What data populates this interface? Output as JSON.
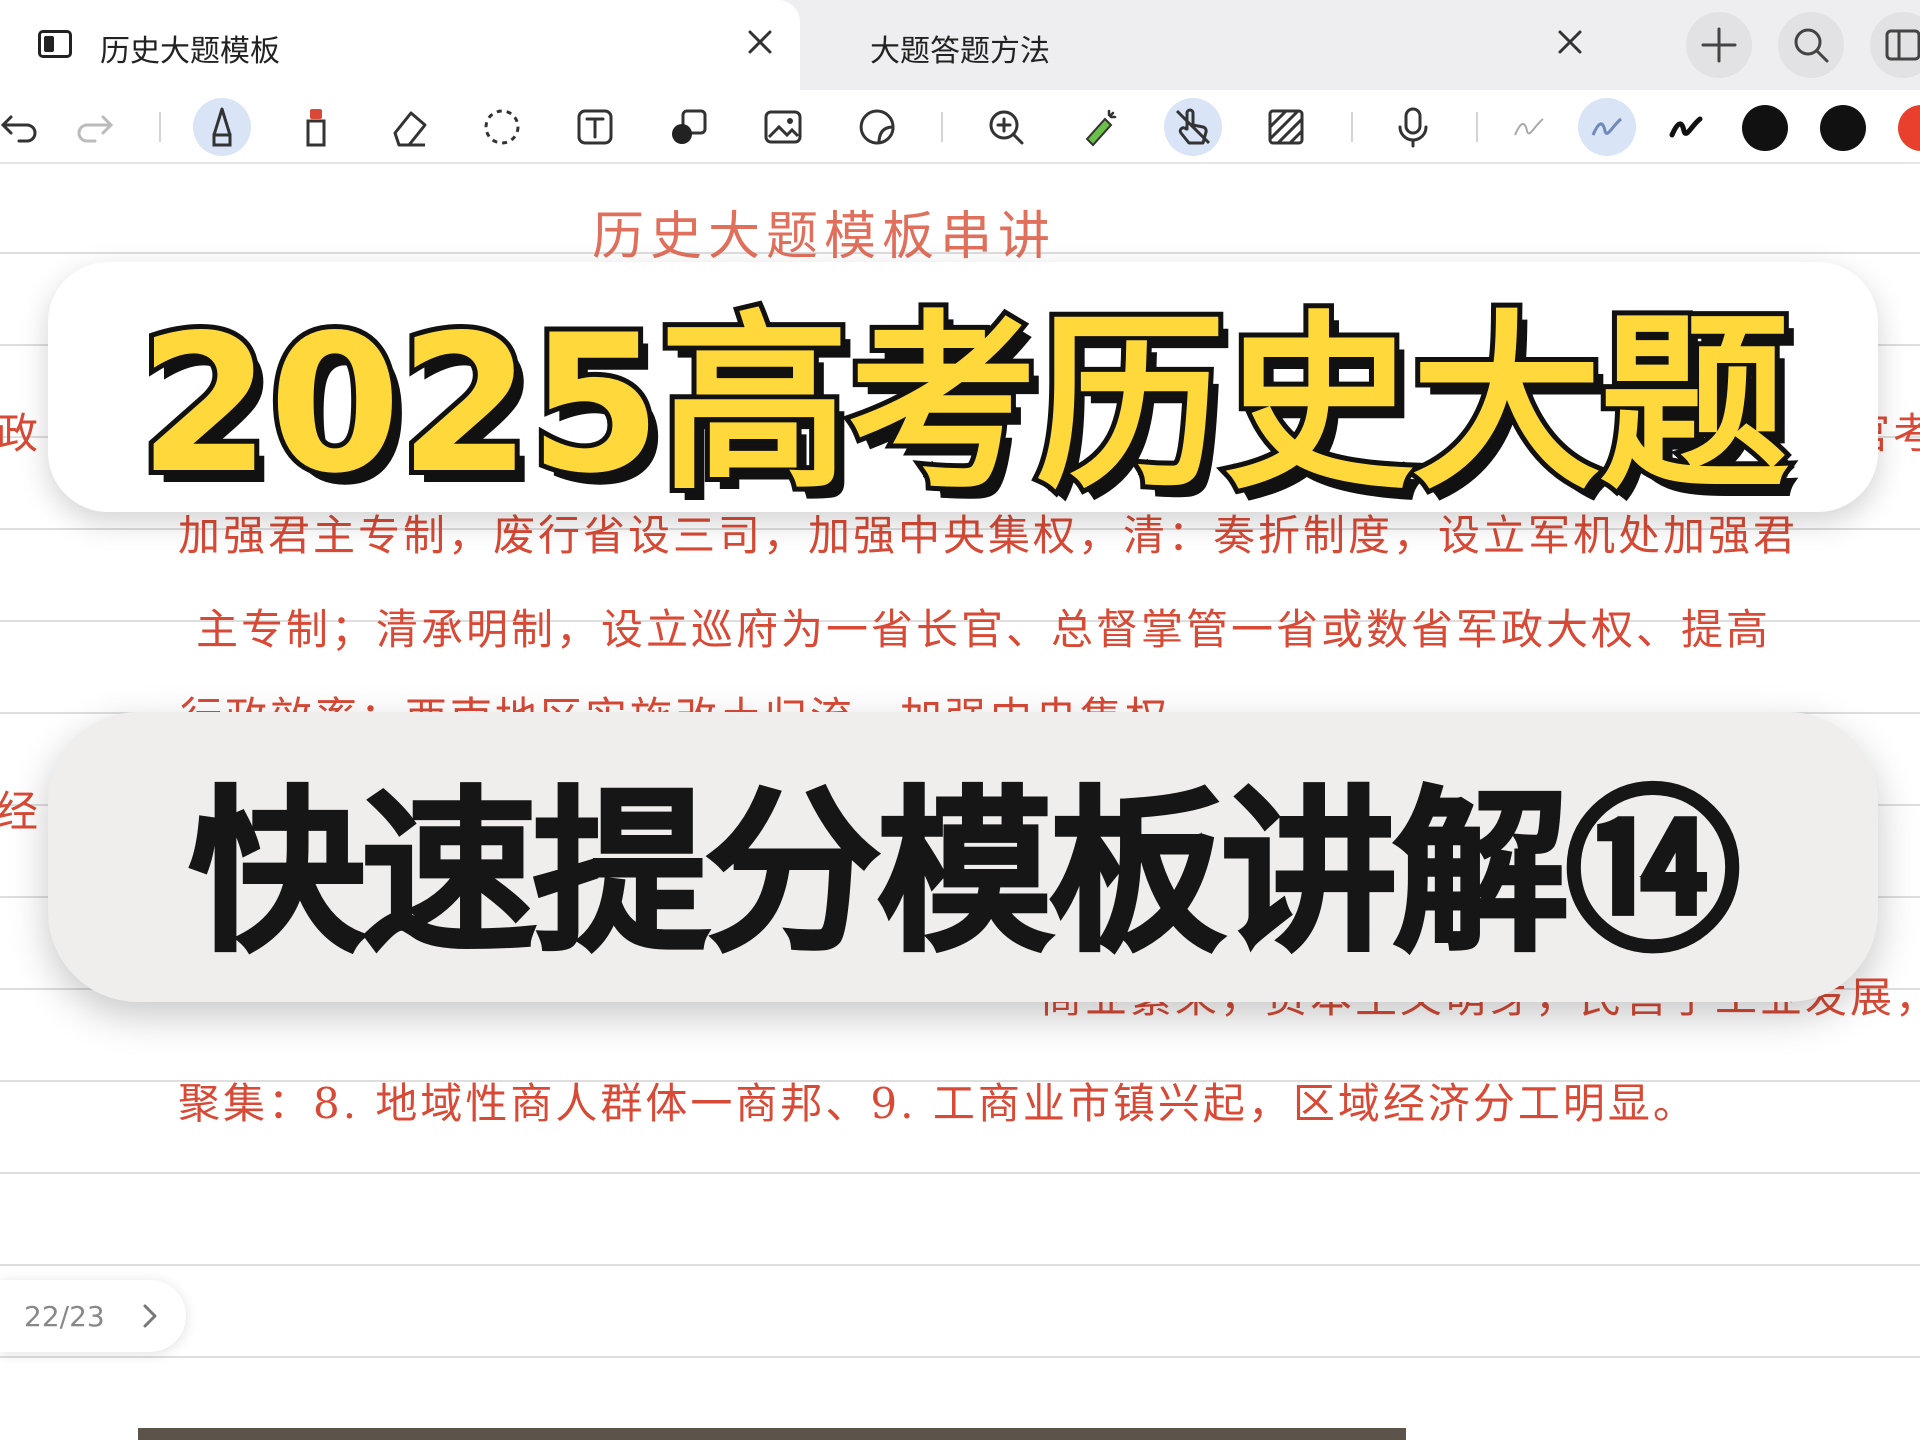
{
  "tabs": [
    {
      "label": "历史大题模板",
      "active": true
    },
    {
      "label": "大题答题方法",
      "active": false
    }
  ],
  "tabbar_buttons": [
    "plus-icon",
    "search-icon",
    "sidebar-icon"
  ],
  "toolbar": {
    "tools": [
      "undo-icon",
      "redo-icon",
      "pen-icon",
      "highlighter-icon",
      "eraser-icon",
      "lasso-icon",
      "text-icon",
      "shapes-icon",
      "image-icon",
      "sticker-icon",
      "zoom-icon",
      "laser-pointer-icon",
      "touch-draw-icon",
      "pattern-icon",
      "microphone-icon",
      "thin-stroke-icon",
      "medium-stroke-icon",
      "thick-stroke-icon"
    ],
    "colors": [
      "#111111",
      "#111111",
      "#e8402c"
    ]
  },
  "note": {
    "title": "历史大题模板串讲",
    "line_gov": "政",
    "line_gov_right": "官考",
    "line_1": "加强君主专制，废行省设三司，加强中央集权，清：奏折制度，设立军机处加强君",
    "line_2": "主专制；清承明制，设立巡府为一省长官、总督掌管一省或数省军政大权、提高",
    "line_3": "行政效率；西南地区实施改土归流，加强中央集权",
    "line_econ": "经",
    "line_4": "商业繁荣，资本主义萌芽，民营手工业发展，商业资本",
    "line_5": "聚集：8. 地域性商人群体一商邦、9. 工商业市镇兴起，区域经济分工明显。"
  },
  "banner_top": "2025高考历史大题",
  "banner_bottom": "快速提分模板讲解⑭",
  "pager": {
    "label": "22/23"
  }
}
